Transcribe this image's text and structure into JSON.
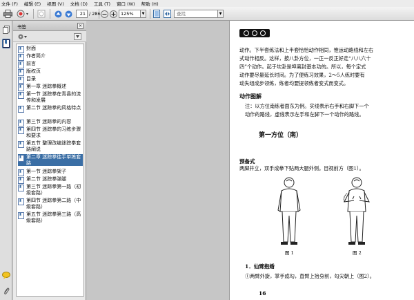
{
  "menu": [
    "文件 (F)",
    "编辑 (E)",
    "视图 (V)",
    "文档 (D)",
    "工具 (T)",
    "窗口 (W)",
    "帮助 (H)"
  ],
  "toolbar": {
    "current_page": "21",
    "total_pages": "/ 286",
    "zoom": "125%",
    "search_placeholder": "查找"
  },
  "bookmarks": {
    "title": "书签",
    "close_label": "×",
    "items": [
      "封面",
      "作者简介",
      "前言",
      "版权页",
      "目录",
      "第一章 迷踪拳概述",
      "第一节 迷踪拳在青县的流传和发展",
      "第二节 迷踪拳的风格特点",
      "第三节 迷踪拳的内容",
      "第四节 迷踪拳的习练步骤和要求",
      "第五节 整理改编迷踪拳套路阐说",
      "第二章 迷踪拳徒手单练套路",
      "第一节 迷踪拳架子",
      "第二节 迷踪拳弹腿",
      "第三节 迷踪拳第一路（初级套路）",
      "第四节 迷踪拳第二路（中级套路）",
      "第五节 迷踪拳第三路（高级套路）"
    ],
    "selected_index": 11
  },
  "document": {
    "para1": [
      "动作。下半套练法和上半套恰恰动作相同，惟运动路线和左右",
      "式动作相反。这样，按八卦方位，一正一反正好走“八八六十",
      "四”个动作。起于坎卦是坤离封基本功的。所以，每个定式",
      "动作要尽量延长时间。为了便练习效果，2～5人练时要有",
      "动失组成步领练，练者均要提领练者变式而变式。"
    ],
    "heading_diagram": "动作图解",
    "para2": [
      "注：以方位南练者面东为例。实线表示右手和右脚下一个",
      "动作的路线，虚线表示左手和左脚下一个动作的路线。"
    ],
    "section_title": "第一方位（南）",
    "sub_heading": "预备式",
    "para3": "两脚并立，双手成拳下贴两大腿外侧。目视前方（图1）。",
    "figure1_caption": "图 1",
    "figure2_caption": "图 2",
    "step_heading": "1．仙臂抱婚",
    "step_text": "①两臂外旋，掌手成勾，直臂上抬身前，勾尖朝上（图2）。",
    "page_number": "16"
  }
}
